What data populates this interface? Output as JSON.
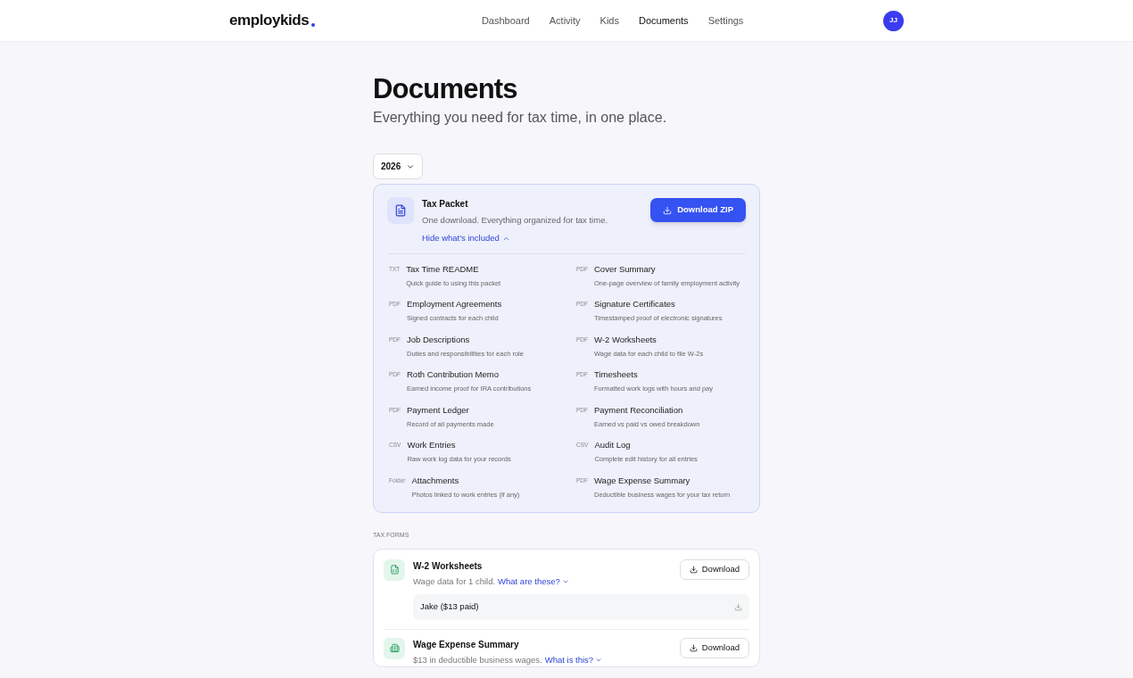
{
  "header": {
    "logo": "employkids",
    "nav": [
      {
        "label": "Dashboard",
        "selected": false
      },
      {
        "label": "Activity",
        "selected": false
      },
      {
        "label": "Kids",
        "selected": false
      },
      {
        "label": "Documents",
        "selected": true
      },
      {
        "label": "Settings",
        "selected": false
      }
    ],
    "avatar": "JJ"
  },
  "page": {
    "title": "Documents",
    "subtitle": "Everything you need for tax time, in one place.",
    "year": "2026"
  },
  "packet": {
    "title": "Tax Packet",
    "description": "One download. Everything organized for tax time.",
    "toggle": "Hide what's included",
    "expanded": true,
    "button": "Download ZIP",
    "items": [
      {
        "type": "TXT",
        "name": "Tax Time README",
        "description": "Quick guide to using this packet"
      },
      {
        "type": "PDF",
        "name": "Cover Summary",
        "description": "One-page overview of family employment activity"
      },
      {
        "type": "PDF",
        "name": "Employment Agreements",
        "description": "Signed contracts for each child"
      },
      {
        "type": "PDF",
        "name": "Signature Certificates",
        "description": "Timestamped proof of electronic signatures"
      },
      {
        "type": "PDF",
        "name": "Job Descriptions",
        "description": "Duties and responsibilities for each role"
      },
      {
        "type": "PDF",
        "name": "W-2 Worksheets",
        "description": "Wage data for each child to file W-2s"
      },
      {
        "type": "PDF",
        "name": "Roth Contribution Memo",
        "description": "Earned income proof for IRA contributions"
      },
      {
        "type": "PDF",
        "name": "Timesheets",
        "description": "Formatted work logs with hours and pay"
      },
      {
        "type": "PDF",
        "name": "Payment Ledger",
        "description": "Record of all payments made"
      },
      {
        "type": "PDF",
        "name": "Payment Reconciliation",
        "description": "Earned vs paid vs owed breakdown"
      },
      {
        "type": "CSV",
        "name": "Work Entries",
        "description": "Raw work log data for your records"
      },
      {
        "type": "CSV",
        "name": "Audit Log",
        "description": "Complete edit history for all entries"
      },
      {
        "type": "Folder",
        "name": "Attachments",
        "description": "Photos linked to work entries (if any)"
      },
      {
        "type": "PDF",
        "name": "Wage Expense Summary",
        "description": "Deductible business wages for your tax return"
      }
    ]
  },
  "tax_forms": {
    "heading": "TAX FORMS",
    "forms": [
      {
        "kind": "worksheet",
        "title": "W-2 Worksheets",
        "description": "Wage data for 1 child.",
        "link": "What are these?",
        "button": "Download",
        "children": [
          {
            "label": "Jake ($13 paid)"
          }
        ]
      },
      {
        "kind": "expense",
        "title": "Wage Expense Summary",
        "description": "$13 in deductible business wages.",
        "link": "What is this?",
        "button": "Download"
      }
    ]
  }
}
